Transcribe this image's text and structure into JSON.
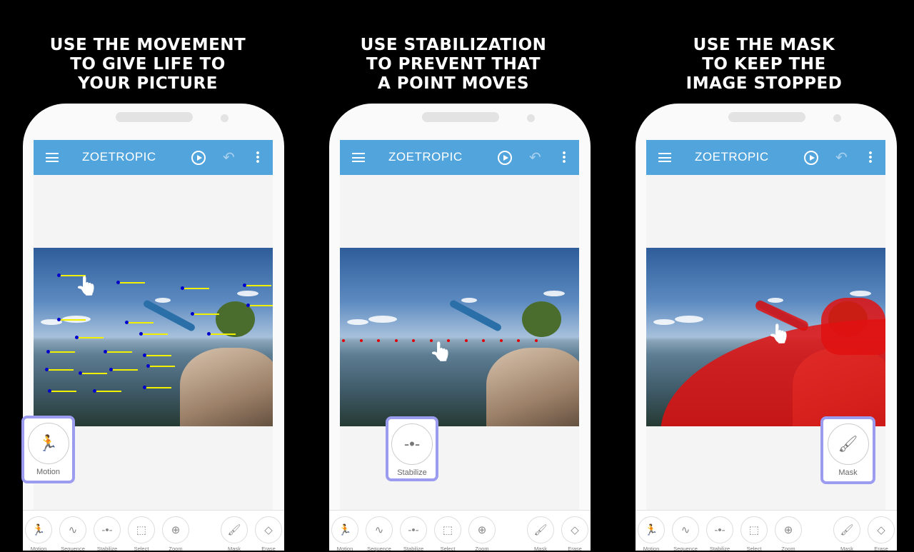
{
  "panels": [
    {
      "caption": [
        "USE THE MOVEMENT",
        "TO GIVE LIFE TO",
        "YOUR PICTURE"
      ],
      "highlight": {
        "label": "Motion",
        "icon": "motion-icon",
        "glyph": "🏃"
      },
      "overlay": "motion-arrows"
    },
    {
      "caption": [
        "USE STABILIZATION",
        "TO PREVENT THAT",
        "A POINT MOVES"
      ],
      "highlight": {
        "label": "Stabilize",
        "icon": "stabilize-icon",
        "glyph": "-•-"
      },
      "overlay": "stabilize-points"
    },
    {
      "caption": [
        "USE THE MASK",
        "TO KEEP THE",
        "IMAGE STOPPED"
      ],
      "highlight": {
        "label": "Mask",
        "icon": "brush-icon",
        "glyph": "🖌"
      },
      "overlay": "red-mask"
    }
  ],
  "app": {
    "title": "ZOETROPIC"
  },
  "tools": [
    {
      "label": "Motion",
      "icon": "motion-icon",
      "glyph": "🏃"
    },
    {
      "label": "Sequence",
      "icon": "sequence-icon",
      "glyph": "∿"
    },
    {
      "label": "Stabilize",
      "icon": "stabilize-icon",
      "glyph": "-•-"
    },
    {
      "label": "Select",
      "icon": "select-icon",
      "glyph": "⬚"
    },
    {
      "label": "Zoom",
      "icon": "zoom-icon",
      "glyph": "⊕"
    },
    {
      "label": "Mask",
      "icon": "brush-icon",
      "glyph": "🖌"
    },
    {
      "label": "Erase",
      "icon": "eraser-icon",
      "glyph": "◇"
    }
  ],
  "colors": {
    "appbar": "#52a4dc",
    "highlight": "#9b9bf0",
    "mask": "#e01010",
    "motion_point": "#0000cc",
    "motion_arrow": "#f0f000",
    "stabilize_point": "#e00000"
  }
}
